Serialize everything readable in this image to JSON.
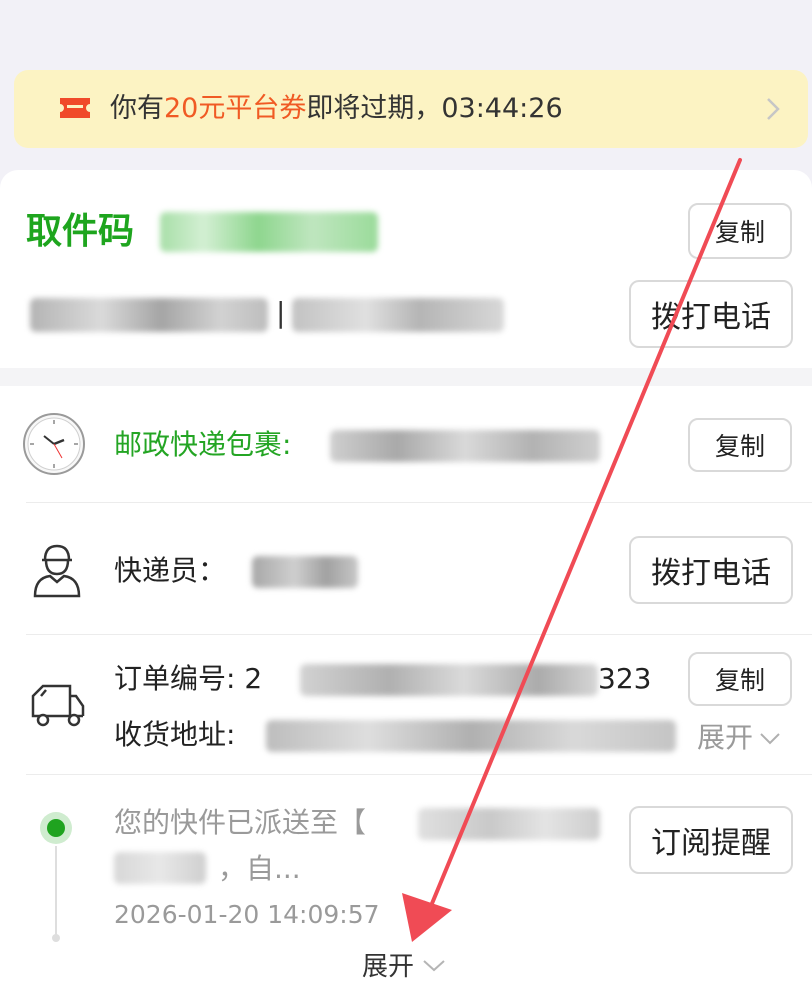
{
  "banner": {
    "prefix": "你有",
    "highlight": "20元平台券",
    "suffix": "即将过期，03:44:26"
  },
  "pickup": {
    "label": "取件码",
    "copy_button": "复制",
    "call_button": "拨打电话",
    "separator": "|"
  },
  "package": {
    "carrier_label": "邮政快递包裹:",
    "copy_button": "复制"
  },
  "courier": {
    "label": "快递员：",
    "call_button": "拨打电话"
  },
  "order": {
    "number_prefix": "订单编号: 2",
    "number_suffix": "323",
    "copy_button": "复制",
    "address_label": "收货地址:",
    "expand": "展开"
  },
  "tracking": {
    "status_line1": "您的快件已派送至【",
    "status_line2": "，自...",
    "timestamp": "2026-01-20 14:09:57",
    "subscribe_button": "订阅提醒"
  },
  "footer": {
    "expand": "展开"
  },
  "colors": {
    "accent_green": "#1ea51e",
    "banner_bg": "#fcf3c3",
    "banner_highlight": "#f05a24",
    "annotation_arrow": "#f04b55"
  },
  "icons": {
    "banner": "coupon-ticket-icon",
    "package": "clock-icon",
    "courier": "courier-person-icon",
    "order": "delivery-truck-icon"
  }
}
